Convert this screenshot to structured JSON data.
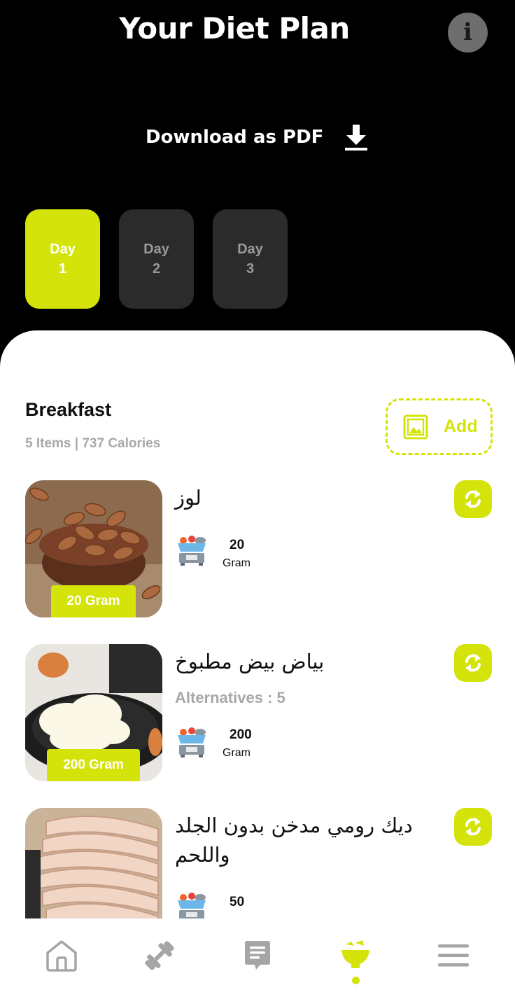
{
  "header": {
    "title": "Your Diet Plan",
    "info_icon": "info-icon",
    "info_glyph": "i",
    "download_label": "Download as PDF",
    "download_icon": "download-icon"
  },
  "days": [
    {
      "label": "Day",
      "number": "1",
      "active": true
    },
    {
      "label": "Day",
      "number": "2",
      "active": false
    },
    {
      "label": "Day",
      "number": "3",
      "active": false
    }
  ],
  "meal": {
    "title": "Breakfast",
    "meta": "5 Items | 737 Calories",
    "add_label": "Add",
    "add_icon": "image-icon"
  },
  "items": [
    {
      "name": "لوز",
      "badge": "20 Gram",
      "quantity": "20",
      "unit": "Gram",
      "alternatives": "",
      "photo": "almonds-photo"
    },
    {
      "name": "بياض بيض  مطبوخ",
      "badge": "200 Gram",
      "quantity": "200",
      "unit": "Gram",
      "alternatives": "Alternatives : 5",
      "photo": "egg-whites-photo"
    },
    {
      "name": "ديك رومي مدخن بدون الجلد واللحم",
      "badge": "",
      "quantity": "50",
      "unit": "",
      "alternatives": "",
      "photo": "smoked-turkey-photo"
    }
  ],
  "nav": [
    "home-icon",
    "dumbbell-icon",
    "notes-icon",
    "diet-bowl-icon",
    "menu-icon"
  ],
  "colors": {
    "accent": "#d4e40a",
    "dark_card": "#2b2b2b",
    "muted_text": "#a8a8a8"
  }
}
